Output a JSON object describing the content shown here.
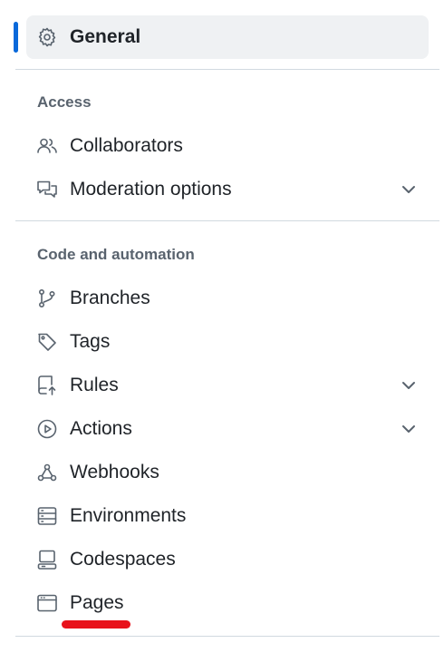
{
  "colors": {
    "accent": "#0969da",
    "active_bg": "#eff1f3",
    "muted_text": "#59636e",
    "divider": "#d1d9e0",
    "annotation": "#e8121b"
  },
  "general": {
    "label": "General",
    "icon": "gear-icon"
  },
  "sections": [
    {
      "heading": "Access",
      "items": [
        {
          "label": "Collaborators",
          "icon": "people-icon"
        },
        {
          "label": "Moderation options",
          "icon": "comment-discussion-icon"
        }
      ]
    },
    {
      "heading": "Code and automation",
      "items": [
        {
          "label": "Branches",
          "icon": "git-branch-icon"
        },
        {
          "label": "Tags",
          "icon": "tag-icon"
        },
        {
          "label": "Rules",
          "icon": "repo-push-icon"
        },
        {
          "label": "Actions",
          "icon": "play-icon"
        },
        {
          "label": "Webhooks",
          "icon": "webhook-icon"
        },
        {
          "label": "Environments",
          "icon": "server-icon"
        },
        {
          "label": "Codespaces",
          "icon": "codespaces-icon"
        },
        {
          "label": "Pages",
          "icon": "browser-icon"
        }
      ]
    }
  ]
}
